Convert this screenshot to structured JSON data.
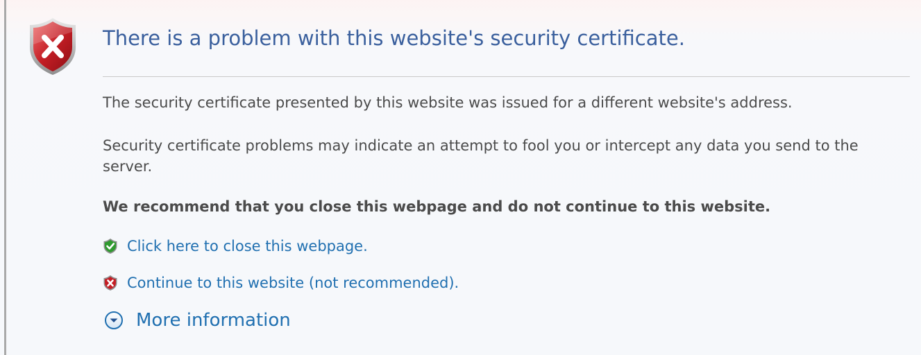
{
  "header": {
    "title": "There is a problem with this website's security certificate.",
    "icon": "error-shield-icon"
  },
  "body": {
    "paragraph1": "The security certificate presented by this website was issued for a different website's address.",
    "paragraph2": "Security certificate problems may indicate an attempt to fool you or intercept any data you send to the server.",
    "recommendation": "We recommend that you close this webpage and do not continue to this website."
  },
  "actions": {
    "close_label": "Click here to close this webpage.",
    "close_icon": "green-shield-check-icon",
    "continue_label": "Continue to this website (not recommended).",
    "continue_icon": "red-shield-x-icon"
  },
  "more": {
    "label": "More information",
    "icon": "chevron-down-circle-icon"
  },
  "colors": {
    "title": "#3a5f9d",
    "link": "#1f6fb0",
    "text": "#4b4b4b",
    "error_red": "#c41e25",
    "safe_green": "#2f9a2f"
  }
}
